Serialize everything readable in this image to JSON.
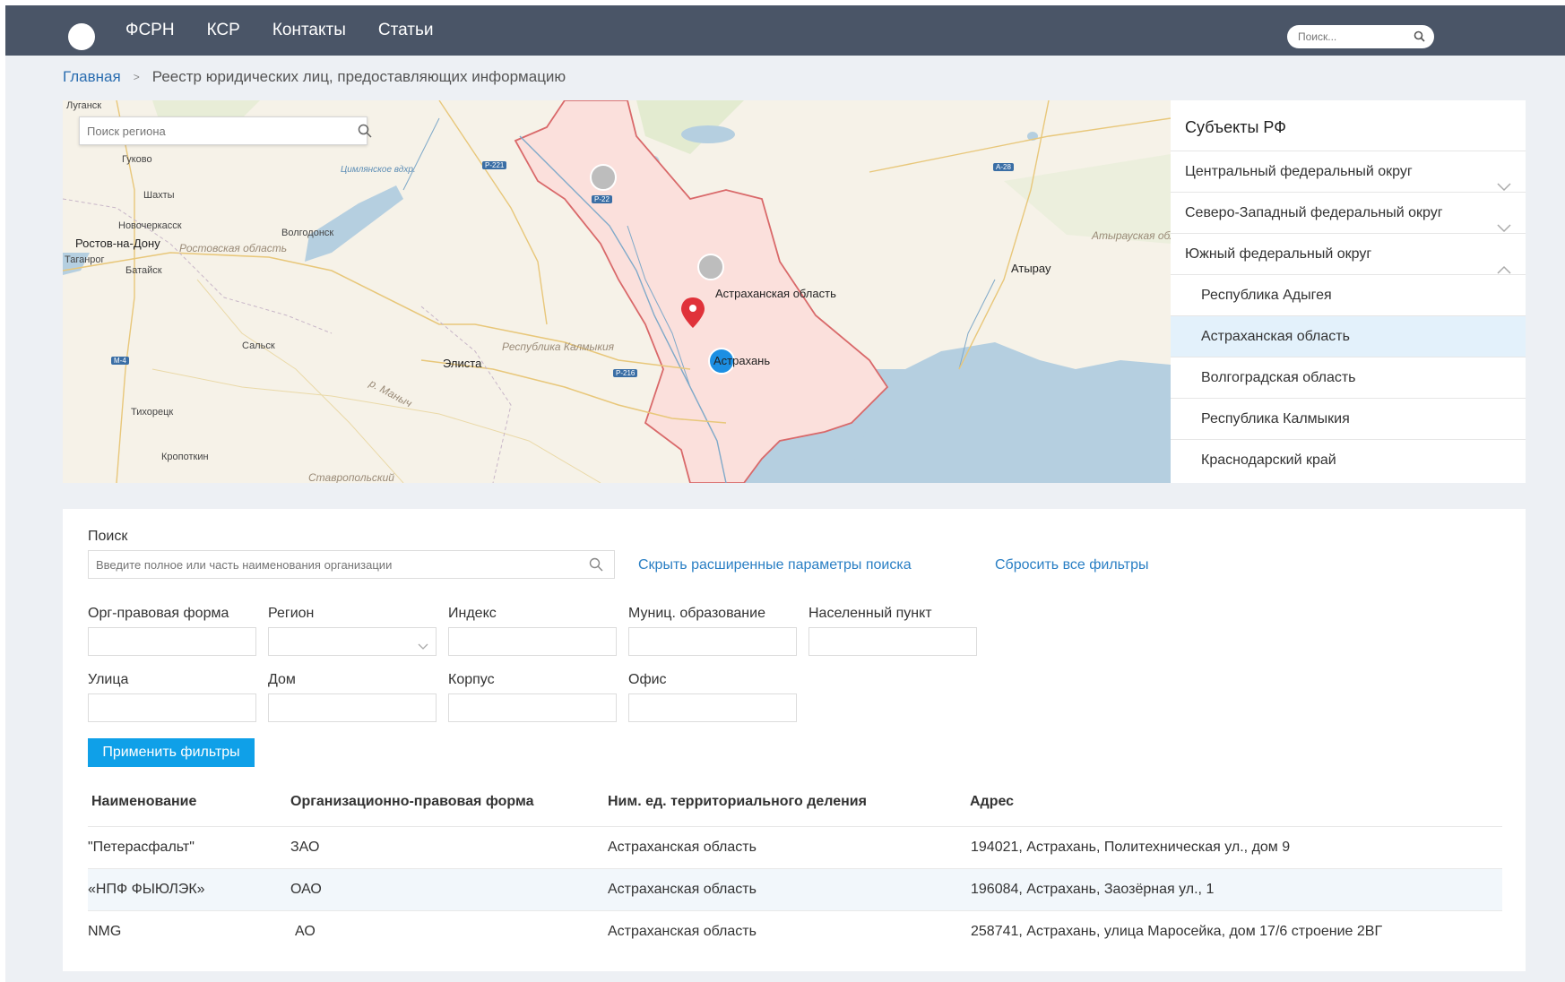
{
  "header": {
    "nav": [
      "ФСРН",
      "КСР",
      "Контакты",
      "Статьи"
    ],
    "search_placeholder": "Поиск..."
  },
  "breadcrumb": {
    "home": "Главная",
    "separator": ">",
    "current": "Реестр юридических лиц, предоставляющих информацию"
  },
  "map": {
    "search_placeholder": "Поиск региона",
    "labels": {
      "lugansk": "Луганск",
      "gukovo": "Гуково",
      "shakhty": "Шахты",
      "novocherkassk": "Новочеркасск",
      "rostov": "Ростов-на-Дону",
      "taganrog": "Таганрог",
      "bataysk": "Батайск",
      "rostov_region": "Ростовская область",
      "volgodonsk": "Волгодонск",
      "tsimlyansk": "Цимлянское вдхр.",
      "salsk": "Сальск",
      "tikhoretsk": "Тихорецк",
      "kropotkin": "Кропоткин",
      "elista": "Элиста",
      "kalmykia": "Республика Калмыкия",
      "astrakhan_region": "Астраханская область",
      "astrakhan": "Астрахань",
      "atyrau": "Атырау",
      "atyrau_region": "Атырауская обл.",
      "manych": "р. Маныч",
      "stavropol": "Ставропольский"
    },
    "roads": [
      "Р-221",
      "Р-22",
      "Р-216",
      "М-4",
      "А-28"
    ]
  },
  "regions": {
    "title": "Субъекты РФ",
    "items": [
      {
        "label": "Центральный федеральный округ",
        "chevron": "down"
      },
      {
        "label": "Северо-Западный федеральный округ",
        "chevron": "down"
      },
      {
        "label": "Южный федеральный округ",
        "chevron": "up"
      },
      {
        "label": "Республика Адыгея",
        "chevron": ""
      },
      {
        "label": "Астраханская область",
        "chevron": ""
      },
      {
        "label": "Волгоградская область",
        "chevron": ""
      },
      {
        "label": "Республика Калмыкия",
        "chevron": ""
      },
      {
        "label": "Краснодарский край",
        "chevron": ""
      }
    ],
    "active": "Астраханская область"
  },
  "filters": {
    "search_label": "Поиск",
    "search_placeholder": "Введите полное или часть наименования организации",
    "hide_advanced": "Скрыть расширенные параметры поиска",
    "reset_all": "Сбросить все фильтры",
    "fields": {
      "org_form": "Орг-правовая форма",
      "region": "Регион",
      "index": "Индекс",
      "municipality": "Муниц. образование",
      "settlement": "Населенный пункт",
      "street": "Улица",
      "house": "Дом",
      "building": "Корпус",
      "office": "Офис"
    },
    "apply": "Применить фильтры"
  },
  "table": {
    "headers": [
      "Наименование",
      "Организационно-правовая форма",
      "Ним. ед. территориального деления",
      "Адрес"
    ],
    "rows": [
      [
        "\"Петерасфальт\"",
        "ЗАО",
        "Астраханская область",
        "194021, Астрахань, Политехническая ул., дом 9"
      ],
      [
        "«НПФ ФЫЮЛЭК»",
        "ОАО",
        "Астраханская область",
        "196084, Астрахань, Заозёрная ул., 1"
      ],
      [
        "NMG",
        "АО",
        "Астраханская область",
        "258741, Астрахань, улица Маросейка, дом 17/6 строение 2ВГ"
      ]
    ]
  },
  "colors": {
    "header_bg": "#4a5567",
    "link": "#2a7fc4",
    "button": "#0fa0e8",
    "active_row": "#e3f1fb",
    "region_fill": "#fbe0dc",
    "region_border": "#d9696a",
    "sea": "#b5cfe0"
  }
}
